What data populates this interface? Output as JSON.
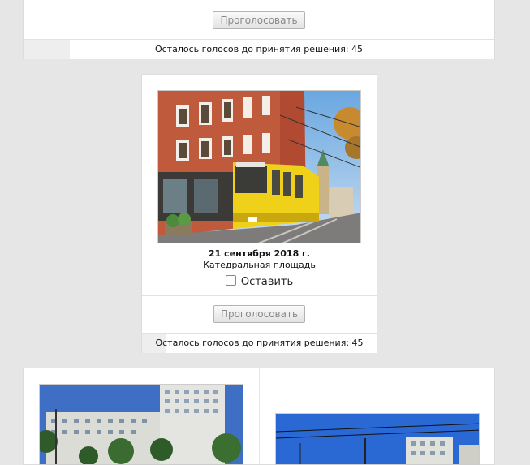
{
  "vote_button_label": "Проголосовать",
  "votes_status": "Осталось голосов до принятия решения: 45",
  "votes_progress_fraction": [
    0.1,
    0.1
  ],
  "photo": {
    "date": "21 сентября 2018 г.",
    "place": "Катедральная площадь",
    "keep_label": "Оставить"
  }
}
